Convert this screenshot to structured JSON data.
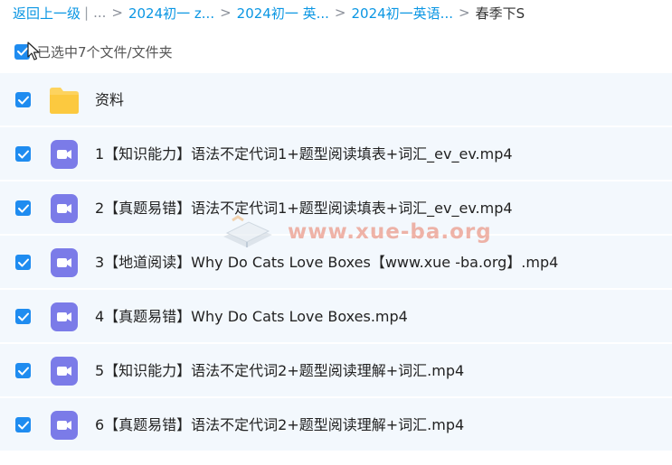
{
  "breadcrumb": {
    "back_label": "返回上一级",
    "divider": "|",
    "ellipsis": "...",
    "separator": ">",
    "crumbs": [
      "2024初一 z...",
      "2024初一 英...",
      "2024初一英语..."
    ],
    "current": "春季下S"
  },
  "selection": {
    "summary": "已选中7个文件/文件夹",
    "all_checked": true
  },
  "files": [
    {
      "name": "资料",
      "type": "folder",
      "checked": true
    },
    {
      "name": "1【知识能力】语法不定代词1+题型阅读填表+词汇_ev_ev.mp4",
      "type": "video",
      "checked": true
    },
    {
      "name": "2【真题易错】语法不定代词1+题型阅读填表+词汇_ev_ev.mp4",
      "type": "video",
      "checked": true
    },
    {
      "name": "3【地道阅读】Why Do Cats Love Boxes【www.xue -ba.org】.mp4",
      "type": "video",
      "checked": true
    },
    {
      "name": "4【真题易错】Why Do Cats Love Boxes.mp4",
      "type": "video",
      "checked": true
    },
    {
      "name": "5【知识能力】语法不定代词2+题型阅读理解+词汇.mp4",
      "type": "video",
      "checked": true
    },
    {
      "name": "6【真题易错】语法不定代词2+题型阅读理解+词汇.mp4",
      "type": "video",
      "checked": true
    }
  ],
  "watermark": {
    "text": "www.xue-ba.org",
    "icon": "book-logo-icon"
  },
  "colors": {
    "accent": "#1f8cf0",
    "link": "#0a96e3",
    "row_bg": "#f3f8fd",
    "folder": "#fdd35e",
    "video": "#7b7be8"
  }
}
